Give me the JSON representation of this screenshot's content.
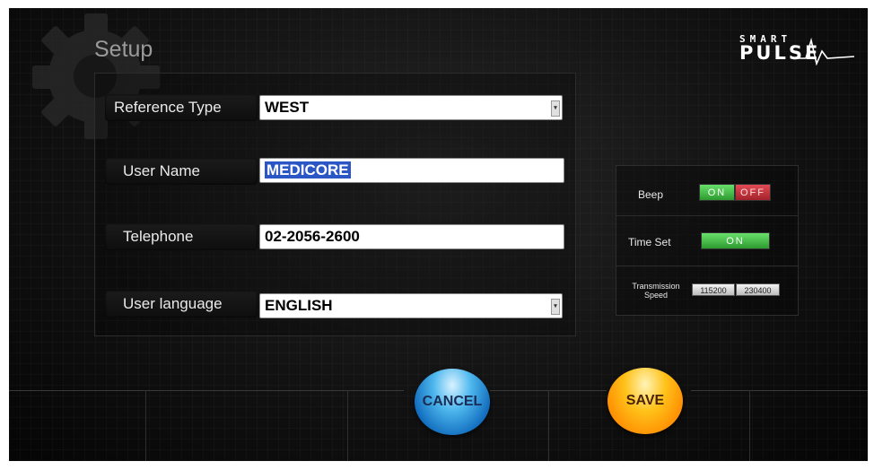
{
  "header": {
    "title": "Setup",
    "logo_line1": "SMART",
    "logo_line2": "PULSE"
  },
  "form": {
    "reference_type": {
      "label": "Reference Type",
      "value": "WEST"
    },
    "user_name": {
      "label": "User Name",
      "value": "MEDICORE"
    },
    "telephone": {
      "label": "Telephone",
      "value": "02-2056-2600"
    },
    "user_language": {
      "label": "User language",
      "value": "ENGLISH"
    }
  },
  "settings": {
    "beep": {
      "label": "Beep",
      "on_label": "ON",
      "off_label": "OFF",
      "state": "on"
    },
    "time_set": {
      "label": "Time Set",
      "on_label": "ON"
    },
    "transmission": {
      "label_line1": "Transmission",
      "label_line2": "Speed",
      "options": [
        "115200",
        "230400"
      ]
    }
  },
  "buttons": {
    "cancel": "CANCEL",
    "save": "SAVE"
  },
  "colors": {
    "on": "#3fbf41",
    "off": "#c8323c",
    "cancel": "#1f8fd8",
    "save": "#ffa500"
  }
}
